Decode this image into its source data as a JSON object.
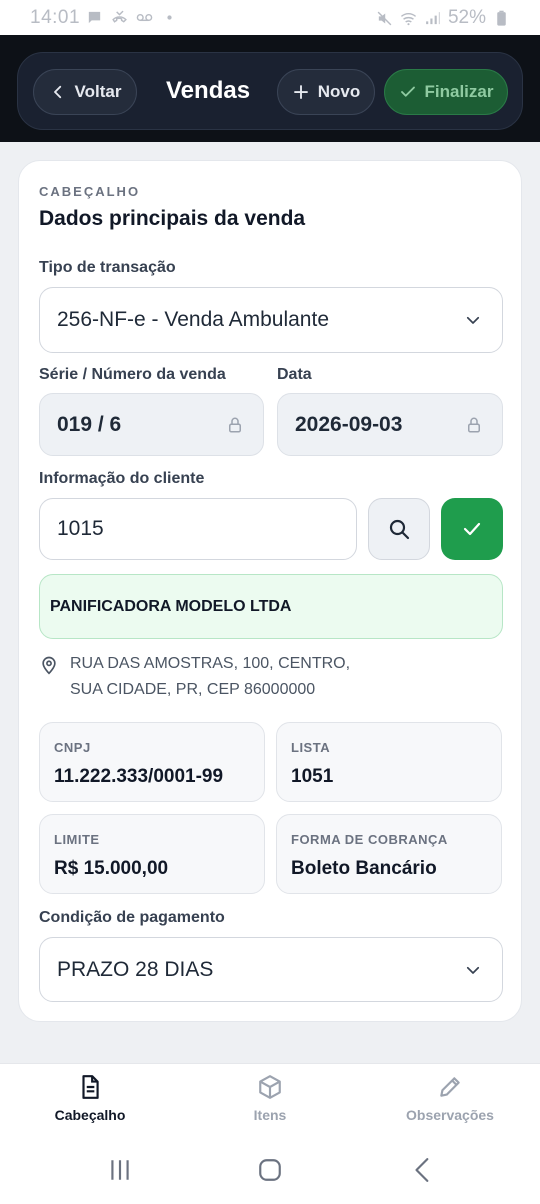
{
  "status_bar": {
    "time": "14:01",
    "battery": "52%",
    "icons": [
      "chat-bubble-icon",
      "missed-call-icon",
      "voicemail-icon",
      "dot-icon",
      "mute-icon",
      "wifi-icon",
      "signal-icon",
      "battery-icon"
    ]
  },
  "header": {
    "back_label": "Voltar",
    "title": "Vendas",
    "new_label": "Novo",
    "finish_label": "Finalizar"
  },
  "form": {
    "overline": "CABEÇALHO",
    "heading": "Dados principais da venda",
    "transaction_type_label": "Tipo de transação",
    "transaction_type_value": "256-NF-e - Venda Ambulante",
    "series_label": "Série / Número da venda",
    "series_value": "019 / 6",
    "date_label": "Data",
    "date_value": "2026-09-03",
    "client_label": "Informação do cliente",
    "client_code": "1015",
    "client_name": "PANIFICADORA MODELO LTDA",
    "address_line1": "RUA DAS AMOSTRAS, 100, CENTRO,",
    "address_line2": "SUA CIDADE, PR, CEP 86000000",
    "cnpj_label": "CNPJ",
    "cnpj_value": "11.222.333/0001-99",
    "list_label": "LISTA",
    "list_value": "1051",
    "limit_label": "LIMITE",
    "limit_value": "R$ 15.000,00",
    "billing_label": "FORMA DE COBRANÇA",
    "billing_value": "Boleto Bancário",
    "payment_condition_label": "Condição de pagamento",
    "payment_condition_value": "PRAZO 28 DIAS"
  },
  "bottom_nav": {
    "tabs": [
      {
        "label": "Cabeçalho",
        "icon": "document-icon",
        "active": true
      },
      {
        "label": "Itens",
        "icon": "box-icon",
        "active": false
      },
      {
        "label": "Observações",
        "icon": "pencil-icon",
        "active": false
      }
    ]
  },
  "colors": {
    "topbar_bg": "#0d1117",
    "accent_green": "#1f9d4d",
    "finish_button_bg": "#1c5d34",
    "client_box_bg": "#ecfbf0"
  }
}
